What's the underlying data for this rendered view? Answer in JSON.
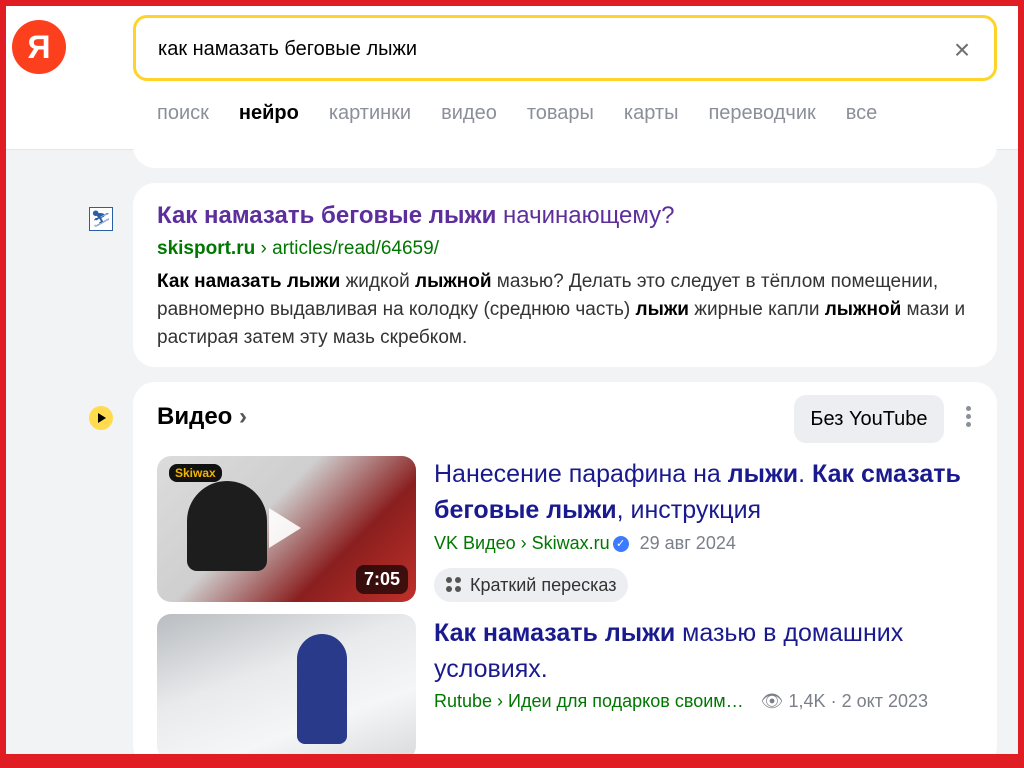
{
  "logo": {
    "letter": "Я"
  },
  "search": {
    "query": "как намазать беговые лыжи",
    "clear_icon": "×"
  },
  "tabs": [
    {
      "label": "поиск",
      "active": false
    },
    {
      "label": "нейро",
      "active": true
    },
    {
      "label": "картинки",
      "active": false
    },
    {
      "label": "видео",
      "active": false
    },
    {
      "label": "товары",
      "active": false
    },
    {
      "label": "карты",
      "active": false
    },
    {
      "label": "переводчик",
      "active": false
    },
    {
      "label": "все",
      "active": false
    }
  ],
  "result": {
    "favicon": "skier-icon",
    "title_bold": "Как намазать беговые лыжи",
    "title_rest": " начинающему?",
    "domain": "skisport.ru",
    "path": " › articles/read/64659/",
    "snippet_parts": [
      {
        "t": "Как намазать лыжи",
        "b": true
      },
      {
        "t": " жидкой ",
        "b": false
      },
      {
        "t": "лыжной",
        "b": true
      },
      {
        "t": " мазью? Делать это следует в тёплом помещении, равномерно выдавливая на колодку (среднюю часть) ",
        "b": false
      },
      {
        "t": "лыжи",
        "b": true
      },
      {
        "t": " жирные капли ",
        "b": false
      },
      {
        "t": "лыжной",
        "b": true
      },
      {
        "t": " мази и растирая затем эту мазь скребком.",
        "b": false
      }
    ]
  },
  "video_section": {
    "heading": "Видео",
    "heading_chevron": "›",
    "yt_button": "Без YouTube",
    "items": [
      {
        "title_parts": [
          {
            "t": "Нанесение парафина на ",
            "b": false
          },
          {
            "t": "лыжи",
            "b": true
          },
          {
            "t": ". ",
            "b": false
          },
          {
            "t": "Как смазать беговые лыжи",
            "b": true
          },
          {
            "t": ", инструкция",
            "b": false
          }
        ],
        "source": "VK Видео › Skiwax.ru",
        "date": "29 авг 2024",
        "duration": "7:05",
        "thumb_brand": "Skiwax",
        "summary_button": "Краткий пересказ"
      },
      {
        "title_parts": [
          {
            "t": "Как намазать лыжи",
            "b": true
          },
          {
            "t": " мазью в домашних условиях.",
            "b": false
          }
        ],
        "source": "Rutube › Идеи для подарков своим…",
        "views": "1,4K",
        "date": "2 окт 2023"
      }
    ]
  }
}
